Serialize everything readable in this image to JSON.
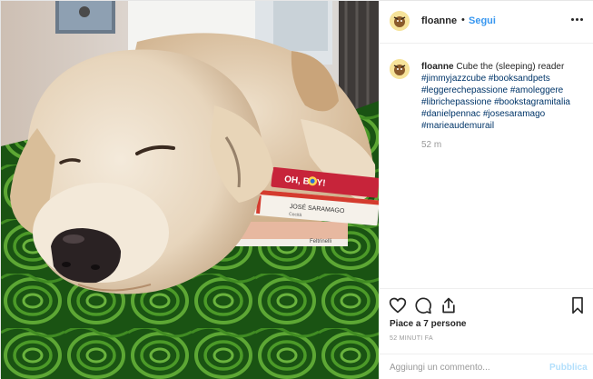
{
  "post": {
    "author": "floanne",
    "follow_label": "Segui",
    "dot": "•",
    "caption": {
      "username": "floanne",
      "text": "Cube the (sleeping) reader",
      "hashtags": [
        "#jimmyjazzcube",
        "#booksandpets",
        "#leggerechepassione",
        "#amoleggere",
        "#librichepassione",
        "#bookstagramitalia",
        "#danielpennac",
        "#josesaramago",
        "#marieaudemurail"
      ],
      "time": "52 m"
    },
    "likes": "Piace a 7 persone",
    "time_ago": "52 MINUTI FA",
    "comment_placeholder": "Aggiungi un commento...",
    "publish_label": "Pubblica"
  },
  "photo": {
    "book_titles": [
      "OH, BOY!",
      "JOSÉ SARAMAGO"
    ],
    "book_sub": [
      "Cecità",
      "Feltrinelli"
    ]
  },
  "icons": {
    "like": "heart-icon",
    "comment": "comment-icon",
    "share": "share-icon",
    "save": "bookmark-icon",
    "more": "more-options-icon"
  },
  "colors": {
    "link": "#3897f0",
    "hashtag": "#003569",
    "publish_disabled": "#b2dffc",
    "blanket_green": "#3f9a2a"
  }
}
